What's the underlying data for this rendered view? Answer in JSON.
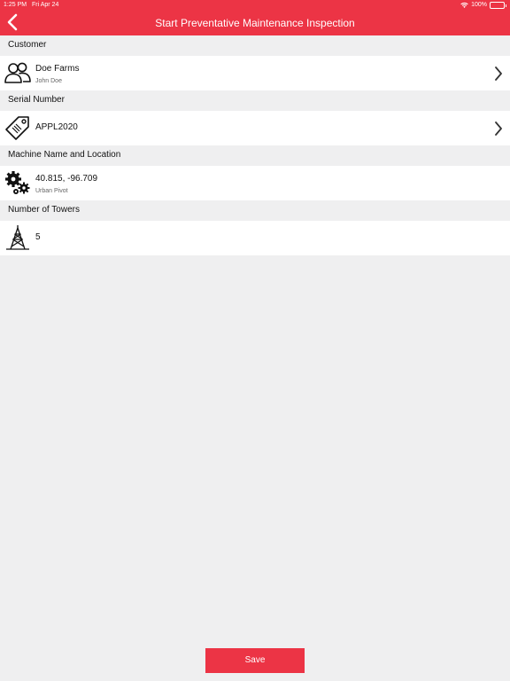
{
  "status_bar": {
    "time": "1:25 PM",
    "date": "Fri Apr 24",
    "battery": "100%"
  },
  "header": {
    "title": "Start Preventative Maintenance Inspection",
    "back_icon": "chevron-left-icon"
  },
  "sections": {
    "customer": {
      "label": "Customer",
      "name": "Doe Farms",
      "contact": "John Doe",
      "icon": "users-icon"
    },
    "serial": {
      "label": "Serial Number",
      "value": "APPL2020",
      "icon": "tag-icon"
    },
    "machine": {
      "label": "Machine Name and Location",
      "coords": "40.815, -96.709",
      "name": "Urban Pivot",
      "icon": "gears-icon"
    },
    "towers": {
      "label": "Number of Towers",
      "value": "5",
      "icon": "tower-icon"
    }
  },
  "save_label": "Save",
  "colors": {
    "accent": "#ec3445",
    "background": "#efeff0"
  }
}
